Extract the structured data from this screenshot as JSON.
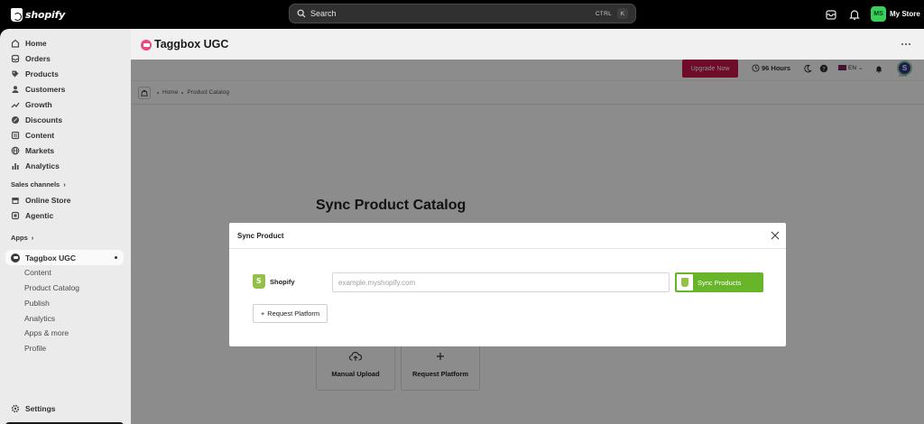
{
  "topbar": {
    "logo_text": "shopify",
    "search_label": "Search",
    "shortcut_ctrl": "CTRL",
    "shortcut_key": "K",
    "store_initials": "MS",
    "store_name": "My Store"
  },
  "sidebar": {
    "items": [
      {
        "label": "Home",
        "icon": "home-icon"
      },
      {
        "label": "Orders",
        "icon": "inbox-icon"
      },
      {
        "label": "Products",
        "icon": "tag-icon"
      },
      {
        "label": "Customers",
        "icon": "person-icon"
      },
      {
        "label": "Growth",
        "icon": "growth-icon"
      },
      {
        "label": "Discounts",
        "icon": "discount-icon"
      },
      {
        "label": "Content",
        "icon": "content-icon"
      },
      {
        "label": "Markets",
        "icon": "globe-icon"
      },
      {
        "label": "Analytics",
        "icon": "chart-icon"
      }
    ],
    "sales_channels_label": "Sales channels",
    "channels": [
      {
        "label": "Online Store",
        "icon": "store-icon"
      },
      {
        "label": "Agentic",
        "icon": "agentic-icon"
      }
    ],
    "apps_label": "Apps",
    "active_app": "Taggbox UGC",
    "app_subitems": [
      "Content",
      "Product Catalog",
      "Publish",
      "Analytics",
      "Apps & more",
      "Profile"
    ],
    "settings_label": "Settings"
  },
  "app": {
    "title": "Taggbox UGC",
    "upgrade_label": "Upgrade Now",
    "hours_label": "96 Hours",
    "lang_label": "EN",
    "profile_initial": "S",
    "profile_pct": "20%",
    "breadcrumb": [
      "Home",
      "Product Catalog"
    ],
    "page_title": "Sync Product Catalog",
    "cards": [
      {
        "label": "Manual Upload",
        "icon": "cloud-upload-icon"
      },
      {
        "label": "Request Platform",
        "icon": "plus-icon"
      }
    ]
  },
  "modal": {
    "title": "Sync Product",
    "platform_label": "Shopify",
    "url_placeholder": "example.myshopify.com",
    "url_value": "",
    "sync_label": "Sync Products",
    "request_label": "Request Platform"
  }
}
